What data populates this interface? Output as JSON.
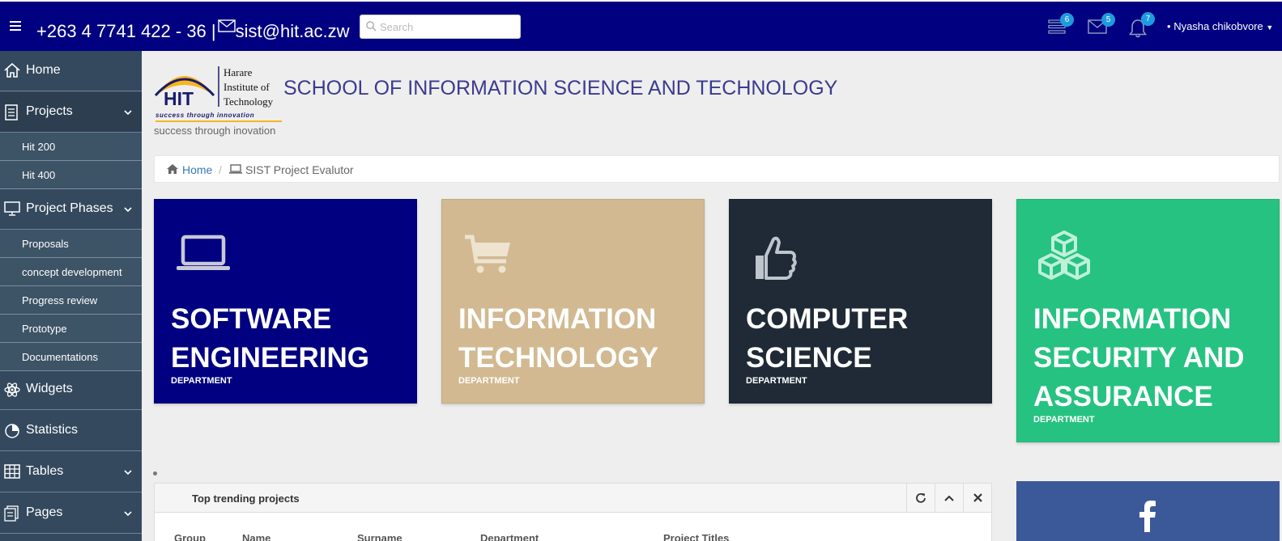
{
  "topbar": {
    "phone": "+263 4 7741 422 - 36 |",
    "email": "sist@hit.ac.zw",
    "search_placeholder": "Search",
    "tasks_badge": "6",
    "messages_badge": "5",
    "notifications_badge": "7",
    "user_name": "Nyasha chikobvore"
  },
  "sidebar": {
    "home": "Home",
    "projects": "Projects",
    "projects_sub": [
      "Hit 200",
      "Hit 400"
    ],
    "phases": "Project Phases",
    "phases_sub": [
      "Proposals",
      "concept development",
      "Progress review",
      "Prototype",
      "Documentations"
    ],
    "widgets": "Widgets",
    "statistics": "Statistics",
    "tables": "Tables",
    "pages": "Pages"
  },
  "header": {
    "logo_text": "HIT",
    "logo_line1": "Harare",
    "logo_line2": "Institute of",
    "logo_line3": "Technology",
    "logo_motto": "success through innovation",
    "tagline": "success through inovation",
    "title": "SCHOOL OF INFORMATION SCIENCE AND TECHNOLOGY"
  },
  "breadcrumb": {
    "home": "Home",
    "current": "SIST Project Evalutor"
  },
  "departments": [
    {
      "line1": "SOFTWARE",
      "line2": "ENGINEERING",
      "line3": "",
      "sub": "DEPARTMENT",
      "color": "#000080",
      "icon": "laptop-icon"
    },
    {
      "line1": "INFORMATION",
      "line2": "TECHNOLOGY",
      "line3": "",
      "sub": "DEPARTMENT",
      "color": "#d2b991",
      "icon": "cart-icon"
    },
    {
      "line1": "COMPUTER",
      "line2": "SCIENCE",
      "line3": "",
      "sub": "DEPARTMENT",
      "color": "#1f2a36",
      "icon": "thumbs-up-icon"
    },
    {
      "line1": "INFORMATION",
      "line2": "SECURITY AND",
      "line3": "ASSURANCE",
      "sub": "DEPARTMENT",
      "color": "#26c281",
      "icon": "cubes-icon"
    }
  ],
  "panel": {
    "title": "Top trending projects",
    "columns": [
      "Group",
      "Name",
      "Surname",
      "Department",
      "Project Titles"
    ]
  },
  "colors": {
    "topbar": "#000080",
    "sidebar": "#34495e",
    "badge": "#1e9be0",
    "facebook": "#3b5998"
  }
}
